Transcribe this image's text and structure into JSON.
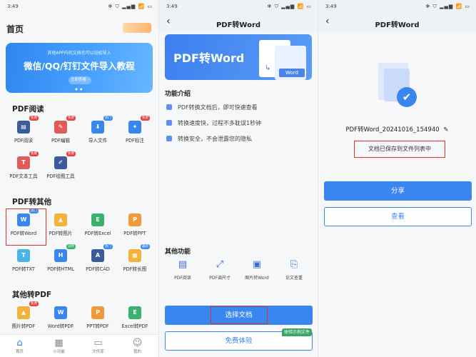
{
  "status_time": "3:49",
  "status_icons": "✻ ⛉ ▂▄▆ 📶 ▭",
  "home": {
    "title": "首页",
    "logo": "·",
    "banner": {
      "small": "其他APP内的文档也可以轻松导入",
      "big": "微信/QQ/钉钉文件导入教程",
      "button": "立即查看 ›",
      "dots": "● ●"
    },
    "sections": [
      {
        "title": "PDF阅读",
        "items": [
          {
            "label": "PDF阅读",
            "icon": "▤",
            "color": "i-navy",
            "badge": "免费",
            "badge_color": "b-red"
          },
          {
            "label": "PDF编辑",
            "icon": "✎",
            "color": "i-red",
            "badge": "免费",
            "badge_color": "b-red"
          },
          {
            "label": "导入文件",
            "icon": "⬇",
            "color": "i-blue",
            "badge": "热门",
            "badge_color": "b-blue"
          },
          {
            "label": "PDF标注",
            "icon": "✦",
            "color": "i-blue",
            "badge": "免费",
            "badge_color": "b-red"
          },
          {
            "label": "PDF文本工具",
            "icon": "T",
            "color": "i-red",
            "badge": "免费",
            "badge_color": "b-red"
          },
          {
            "label": "PDF绘图工具",
            "icon": "✐",
            "color": "i-navy",
            "badge": "免费",
            "badge_color": "b-red"
          }
        ]
      },
      {
        "title": "PDF转其他",
        "items": [
          {
            "label": "PDF转Word",
            "icon": "W",
            "color": "i-blue",
            "badge": "热门",
            "badge_color": "b-blue"
          },
          {
            "label": "PDF转图片",
            "icon": "▲",
            "color": "i-gold",
            "badge": "",
            "badge_color": ""
          },
          {
            "label": "PDF转Excel",
            "icon": "E",
            "color": "i-green",
            "badge": "",
            "badge_color": ""
          },
          {
            "label": "PDF转PPT",
            "icon": "P",
            "color": "i-orange",
            "badge": "",
            "badge_color": ""
          },
          {
            "label": "PDF转TXT",
            "icon": "T",
            "color": "i-teal",
            "badge": "",
            "badge_color": ""
          },
          {
            "label": "PDF转HTML",
            "icon": "H",
            "color": "i-blue",
            "badge": "试用",
            "badge_color": "b-green"
          },
          {
            "label": "PDF转CAD",
            "icon": "A",
            "color": "i-navy",
            "badge": "热门",
            "badge_color": "b-blue"
          },
          {
            "label": "PDF转长图",
            "icon": "▦",
            "color": "i-gold",
            "badge": "最新",
            "badge_color": "b-blue"
          }
        ]
      },
      {
        "title": "其他转PDF",
        "items": [
          {
            "label": "图片转PDF",
            "icon": "▲",
            "color": "i-gold",
            "badge": "免费",
            "badge_color": "b-red"
          },
          {
            "label": "Word转PDF",
            "icon": "W",
            "color": "i-blue",
            "badge": "",
            "badge_color": ""
          },
          {
            "label": "PPT转PDF",
            "icon": "P",
            "color": "i-orange",
            "badge": "",
            "badge_color": ""
          },
          {
            "label": "Excel转PDF",
            "icon": "E",
            "color": "i-green",
            "badge": "",
            "badge_color": ""
          }
        ]
      }
    ],
    "nav": [
      {
        "label": "首页",
        "icon": "⌂",
        "active": true
      },
      {
        "label": "小功能",
        "icon": "▦",
        "active": false
      },
      {
        "label": "文件库",
        "icon": "▭",
        "active": false
      },
      {
        "label": "我的",
        "icon": "☺",
        "active": false
      }
    ]
  },
  "convert": {
    "title": "PDF转Word",
    "back": "‹",
    "hero_title": "PDF转Word",
    "hero_badge": "Word",
    "hero_arrow": "↳",
    "intro_title": "功能介绍",
    "features": [
      "PDF转换文档后，即可快速查看",
      "转换速度快，过程不多耽误1秒钟",
      "转换安全，不会泄露您的隐私"
    ],
    "other_title": "其他功能",
    "other_funcs": [
      {
        "label": "PDF阅读",
        "icon": "▤"
      },
      {
        "label": "PDF调尺寸",
        "icon": "⤢"
      },
      {
        "label": "图片转Word",
        "icon": "▣"
      },
      {
        "label": "论文查重",
        "icon": "⎘"
      }
    ],
    "select_label": "选择文档",
    "trial_label": "免费体验",
    "trial_tag": "体验示例文件"
  },
  "result": {
    "title": "PDF转Word",
    "back": "‹",
    "check_icon": "✔",
    "edit_icon": "✎",
    "filename": "PDF转Word_20241016_154940",
    "saved_msg": "文档已保存到文件列表中",
    "share_label": "分享",
    "view_label": "查看"
  }
}
